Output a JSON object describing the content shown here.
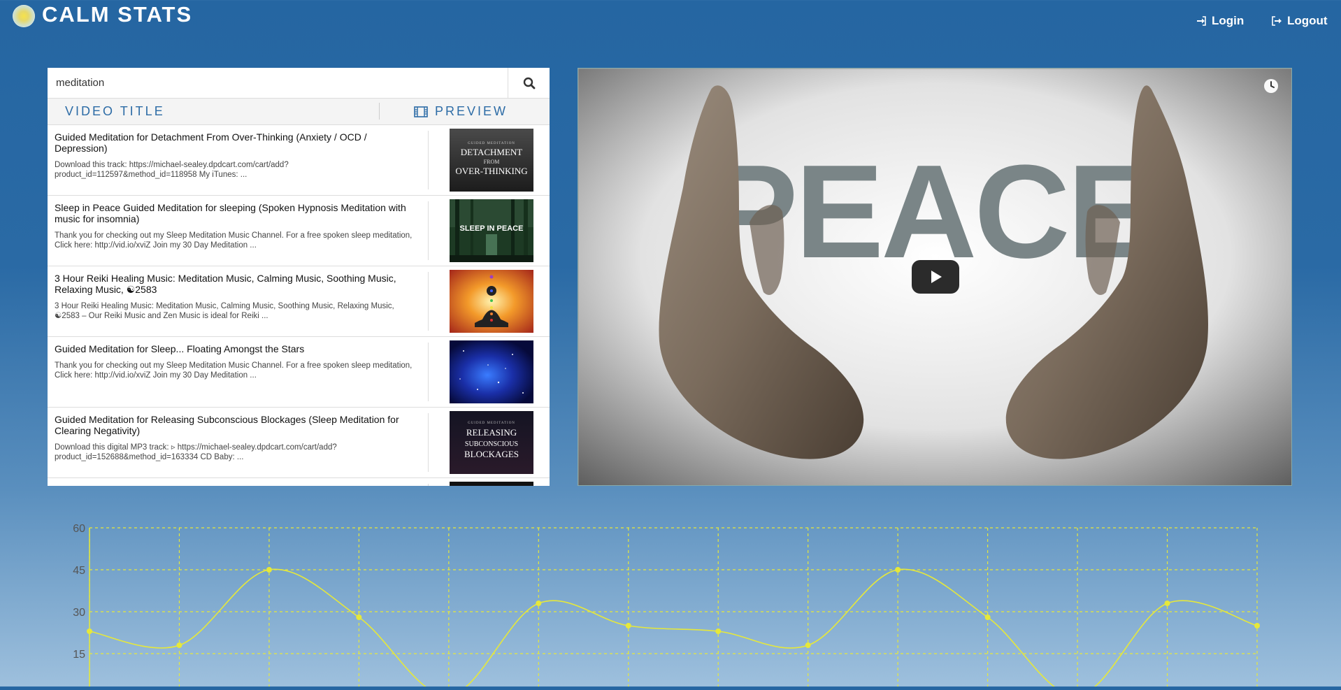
{
  "app": {
    "title": "CALM STATS"
  },
  "nav": {
    "login": "Login",
    "logout": "Logout"
  },
  "search": {
    "value": "meditation"
  },
  "table": {
    "col_title": "VIDEO TITLE",
    "col_preview": "PREVIEW",
    "rows": [
      {
        "title": "Guided Meditation for Detachment From Over-Thinking (Anxiety / OCD / Depression)",
        "desc": "Download this track: https://michael-sealey.dpdcart.com/cart/add?product_id=112597&method_id=118958 My iTunes: ...",
        "thumb_lines": [
          "GUIDED MEDITATION",
          "DETACHMENT",
          "FROM",
          "OVER-THINKING"
        ]
      },
      {
        "title": "Sleep in Peace Guided Meditation for sleeping (Spoken Hypnosis Meditation with music for insomnia)",
        "desc": "Thank you for checking out my Sleep Meditation Music Channel. For a free spoken sleep meditation, Click here: http://vid.io/xviZ Join my 30 Day Meditation ...",
        "thumb_lines": [
          "SLEEP IN PEACE"
        ]
      },
      {
        "title": "3 Hour Reiki Healing Music: Meditation Music, Calming Music, Soothing Music, Relaxing Music, ☯2583",
        "desc": "3 Hour Reiki Healing Music: Meditation Music, Calming Music, Soothing Music, Relaxing Music, ☯2583 – Our Reiki Music and Zen Music is ideal for Reiki ...",
        "thumb_lines": []
      },
      {
        "title": "Guided Meditation for Sleep... Floating Amongst the Stars",
        "desc": "Thank you for checking out my Sleep Meditation Music Channel. For a free spoken sleep meditation, Click here: http://vid.io/xviZ Join my 30 Day Meditation ...",
        "thumb_lines": []
      },
      {
        "title": "Guided Meditation for Releasing Subconscious Blockages (Sleep Meditation for Clearing Negativity)",
        "desc": "Download this digital MP3 track: ▹ https://michael-sealey.dpdcart.com/cart/add?product_id=152688&method_id=163334 CD Baby: ...",
        "thumb_lines": [
          "GUIDED MEDITATION",
          "RELEASING",
          "SUBCONSCIOUS",
          "BLOCKAGES"
        ]
      }
    ]
  },
  "video": {
    "overlay_text": "PEACE"
  },
  "colors": {
    "accent": "#2d6ca6",
    "line": "#e6e83a",
    "grid": "#e6e83a"
  },
  "chart_data": {
    "type": "line",
    "yticks": [
      15,
      30,
      45,
      60
    ],
    "ylim": [
      0,
      60
    ],
    "grid": true,
    "values": [
      23,
      18,
      45,
      28,
      0,
      33,
      25,
      23,
      18,
      45,
      28,
      0,
      33,
      25
    ]
  }
}
